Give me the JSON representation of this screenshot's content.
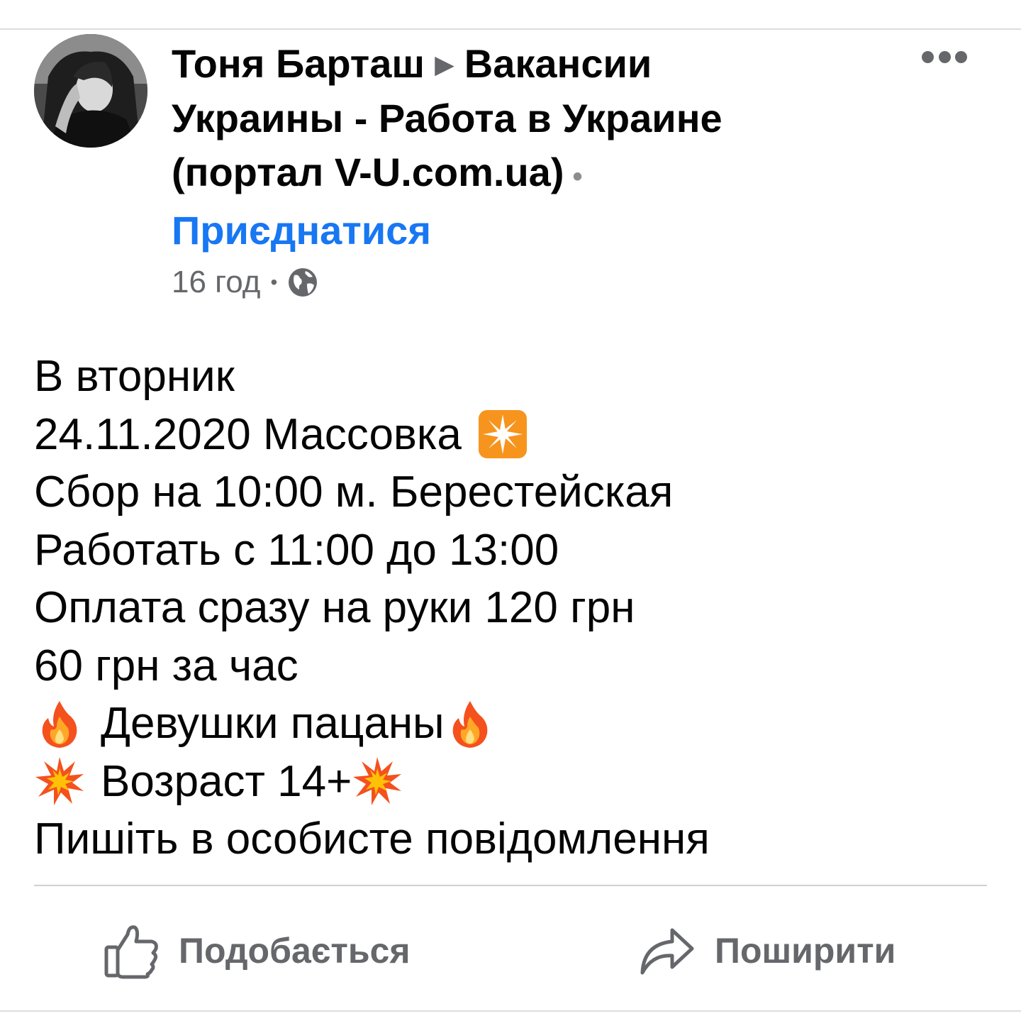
{
  "post": {
    "author": "Тоня Барташ",
    "group": "Вакансии Украины - Работа в Украине (портал V-U.com.ua)",
    "join_label": "Приєднатися",
    "time": "16 год",
    "privacy_icon": "globe-icon",
    "more_icon": "more-options-icon",
    "lines": [
      {
        "text": "В вторник",
        "emoji_before": null,
        "emoji_after": null
      },
      {
        "text": "24.11.2020 Массовка",
        "emoji_before": null,
        "emoji_after": "eight-pointed-star"
      },
      {
        "text": "Сбор на 10:00 м. Берестейская",
        "emoji_before": null,
        "emoji_after": null
      },
      {
        "text": "Работать с 11:00 до 13:00",
        "emoji_before": null,
        "emoji_after": null
      },
      {
        "text": "Оплата сразу на руки 120 грн",
        "emoji_before": null,
        "emoji_after": null
      },
      {
        "text": "60 грн за час",
        "emoji_before": null,
        "emoji_after": null
      },
      {
        "text": "Девушки пацаны",
        "emoji_before": "fire",
        "emoji_after": "fire"
      },
      {
        "text": "Возраст 14+",
        "emoji_before": "collision",
        "emoji_after": "collision"
      },
      {
        "text": "Пишіть в особисте повідомлення",
        "emoji_before": null,
        "emoji_after": null
      }
    ]
  },
  "actions": {
    "like_label": "Подобається",
    "like_icon": "thumbs-up-icon",
    "share_label": "Поширити",
    "share_icon": "share-arrow-icon"
  },
  "colors": {
    "link": "#1877f2",
    "secondary_text": "#65676b",
    "primary_text": "#050505",
    "divider": "#ced0d4"
  }
}
